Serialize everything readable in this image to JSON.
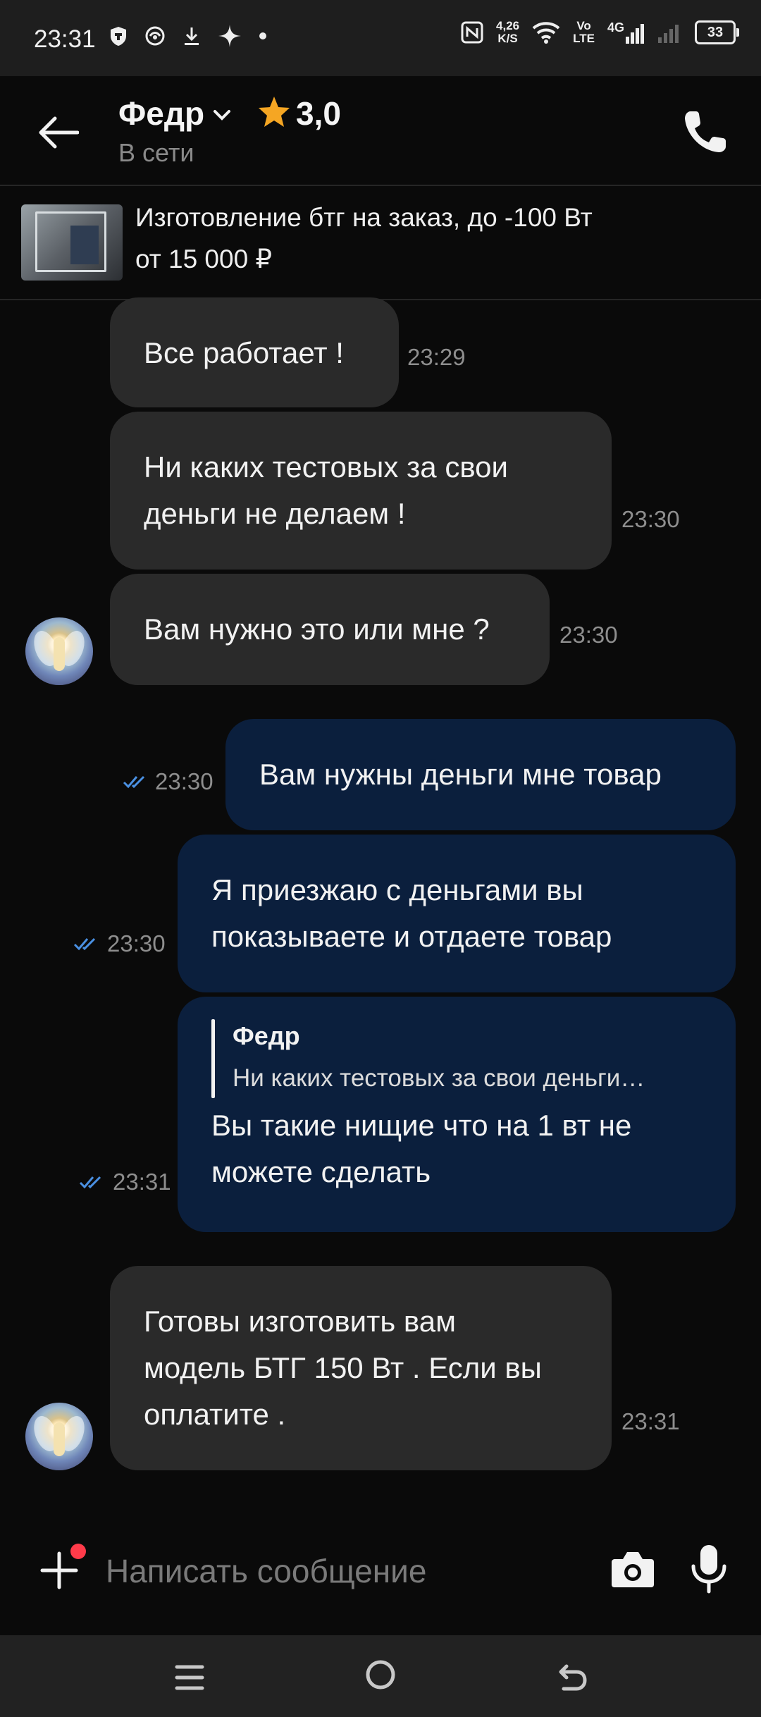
{
  "status_bar": {
    "time": "23:31",
    "speed_value": "4,26",
    "speed_unit": "K/S",
    "volte_top": "Vo",
    "volte_bottom": "LTE",
    "network": "4G",
    "battery": "33",
    "icons": [
      "shield-icon",
      "vpn-icon",
      "download-icon",
      "sparkle-icon",
      "dot-icon",
      "nfc-icon",
      "wifi-icon",
      "signal-icon",
      "battery-icon"
    ]
  },
  "header": {
    "name": "Федр",
    "rating": "3,0",
    "status": "В сети"
  },
  "listing": {
    "title": "Изготовление бтг на заказ, до -100 Вт",
    "price": "от 15 000 ₽"
  },
  "messages": [
    {
      "dir": "in",
      "text": "Все работает !",
      "time": "23:29"
    },
    {
      "dir": "in",
      "text_lines": [
        "Ни каких тестовых за свои",
        "деньги не делаем !"
      ],
      "time": "23:30"
    },
    {
      "dir": "in",
      "text": "Вам нужно это или мне ?",
      "time": "23:30"
    },
    {
      "dir": "out",
      "text": "Вам нужны деньги мне товар",
      "time": "23:30",
      "read": true
    },
    {
      "dir": "out",
      "text_lines": [
        "Я приезжаю с деньгами вы",
        "показываете и отдаете товар"
      ],
      "time": "23:30",
      "read": true
    },
    {
      "dir": "out",
      "quote_name": "Федр",
      "quote_text": "Ни каких тестовых за свои деньги…",
      "text_lines": [
        "Вы такие нищие что на 1 вт не",
        "можете сделать"
      ],
      "time": "23:31",
      "read": true
    },
    {
      "dir": "in",
      "text_lines": [
        "Готовы изготовить вам",
        "модель БТГ 150 Вт . Если вы",
        "оплатите ."
      ],
      "time": "23:31"
    }
  ],
  "composer": {
    "placeholder": "Написать сообщение"
  },
  "colors": {
    "incoming_bubble": "#2a2a2a",
    "outgoing_bubble": "#0b1f3d",
    "star": "#f5a623",
    "tick": "#4a90e2",
    "badge": "#ff3b4a"
  }
}
